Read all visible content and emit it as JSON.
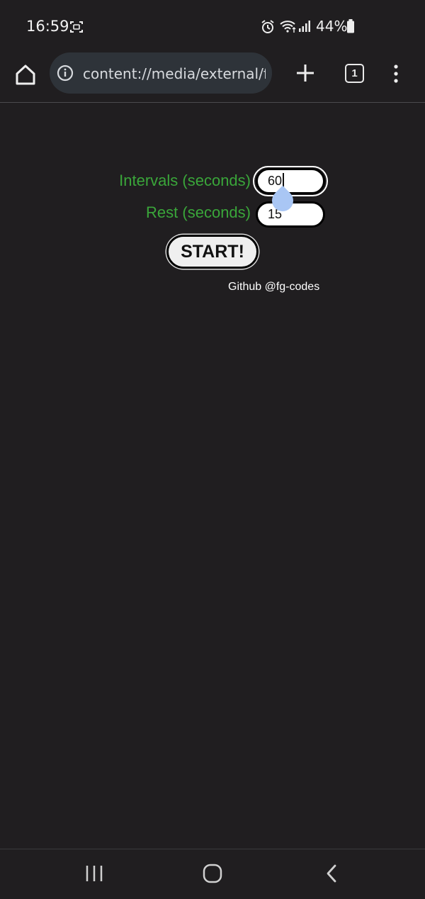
{
  "status_bar": {
    "time": "16:59",
    "battery": "44%",
    "icons": [
      "screenshot-icon",
      "alarm-icon",
      "wifi-icon",
      "signal-icon",
      "battery-icon"
    ]
  },
  "browser": {
    "url": "content://media/external/file",
    "tab_count": "1"
  },
  "form": {
    "intervals_label": "Intervals (seconds)",
    "intervals_value": "60",
    "rest_label": "Rest (seconds)",
    "rest_value": "15",
    "start_label": "START!"
  },
  "footer": {
    "github_text": "Github @fg-codes"
  },
  "colors": {
    "background": "#201e20",
    "label_green": "#3aa63a",
    "url_bar": "#2e3339"
  }
}
